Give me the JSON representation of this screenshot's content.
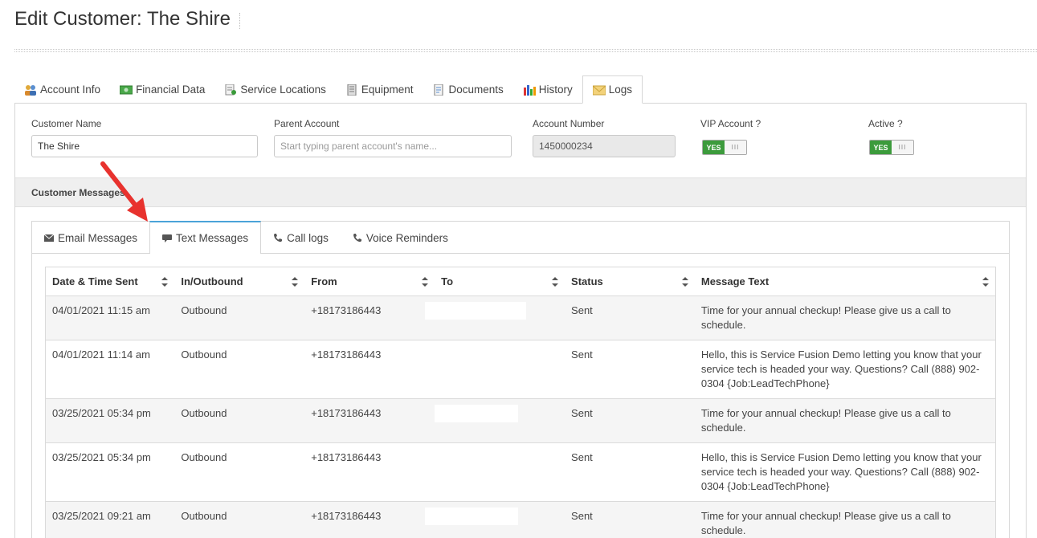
{
  "page": {
    "title": "Edit Customer: The Shire"
  },
  "main_tabs": [
    {
      "label": "Account Info",
      "icon": "users-icon"
    },
    {
      "label": "Financial Data",
      "icon": "money-icon"
    },
    {
      "label": "Service Locations",
      "icon": "location-doc-icon"
    },
    {
      "label": "Equipment",
      "icon": "equipment-icon"
    },
    {
      "label": "Documents",
      "icon": "document-icon"
    },
    {
      "label": "History",
      "icon": "history-chart-icon"
    },
    {
      "label": "Logs",
      "icon": "envelope-icon",
      "active": true
    }
  ],
  "form": {
    "customer_name": {
      "label": "Customer Name",
      "value": "The Shire"
    },
    "parent_account": {
      "label": "Parent Account",
      "placeholder": "Start typing parent account's name..."
    },
    "account_number": {
      "label": "Account Number",
      "value": "1450000234"
    },
    "vip_account": {
      "label": "VIP Account ?",
      "value": "YES",
      "knob": "III"
    },
    "active": {
      "label": "Active ?",
      "value": "YES",
      "knob": "III"
    }
  },
  "section": {
    "title": "Customer Messages"
  },
  "sub_tabs": [
    {
      "label": "Email Messages",
      "icon": "envelope-icon"
    },
    {
      "label": "Text Messages",
      "icon": "chat-bubble-icon",
      "active": true
    },
    {
      "label": "Call logs",
      "icon": "phone-icon"
    },
    {
      "label": "Voice Reminders",
      "icon": "phone-icon"
    }
  ],
  "table": {
    "headers": [
      "Date & Time Sent",
      "In/Outbound",
      "From",
      "To",
      "Status",
      "Message Text"
    ],
    "rows": [
      [
        "04/01/2021 11:15 am",
        "Outbound",
        "+18173186443",
        "",
        "Sent",
        "Time for your annual checkup! Please give us a call to schedule."
      ],
      [
        "04/01/2021 11:14 am",
        "Outbound",
        "+18173186443",
        "",
        "Sent",
        "Hello, this is Service Fusion Demo letting you know that your service tech is headed your way. Questions? Call (888) 902-0304 {Job:LeadTechPhone}"
      ],
      [
        "03/25/2021 05:34 pm",
        "Outbound",
        "+18173186443",
        "",
        "Sent",
        "Time for your annual checkup! Please give us a call to schedule."
      ],
      [
        "03/25/2021 05:34 pm",
        "Outbound",
        "+18173186443",
        "",
        "Sent",
        "Hello, this is Service Fusion Demo letting you know that your service tech is headed your way. Questions? Call (888) 902-0304 {Job:LeadTechPhone}"
      ],
      [
        "03/25/2021 09:21 am",
        "Outbound",
        "+18173186443",
        "",
        "Sent",
        "Time for your annual checkup! Please give us a call to schedule."
      ]
    ]
  },
  "colors": {
    "toggle_on": "#3c9b3c",
    "active_subtab_border": "#4aa3d8",
    "annotation_arrow": "#e8322e"
  }
}
